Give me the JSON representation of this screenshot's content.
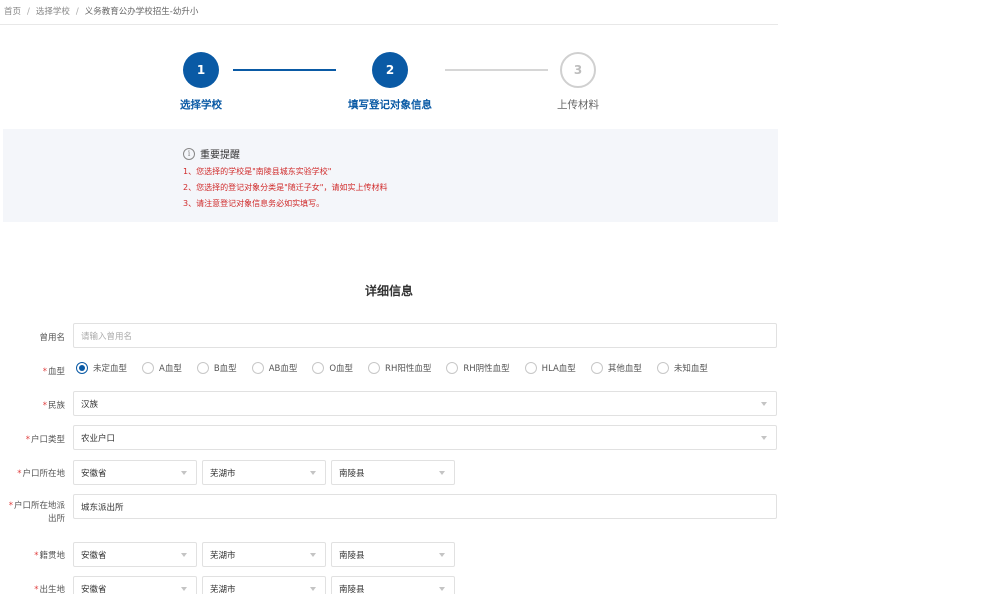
{
  "breadcrumb": {
    "home": "首页",
    "select_school": "选择学校",
    "current": "义务教育公办学校招生-幼升小"
  },
  "steps": [
    {
      "number": "1",
      "label": "选择学校",
      "state": "done"
    },
    {
      "number": "2",
      "label": "填写登记对象信息",
      "state": "done"
    },
    {
      "number": "3",
      "label": "上传材料",
      "state": "todo"
    }
  ],
  "notice": {
    "icon": "info-icon",
    "icon_glyph": "i",
    "title": "重要提醒",
    "lines": [
      "1、您选择的学校是\"南陵县城东实验学校\"",
      "2、您选择的登记对象分类是\"随迁子女\"，请如实上传材料",
      "3、请注意登记对象信息务必如实填写。"
    ]
  },
  "section_title": "详细信息",
  "form": {
    "former_name": {
      "label": "曾用名",
      "placeholder": "请输入曾用名"
    },
    "blood_type": {
      "label": "血型",
      "options": [
        "未定血型",
        "A血型",
        "B血型",
        "AB血型",
        "O血型",
        "RH阳性血型",
        "RH阴性血型",
        "HLA血型",
        "其他血型",
        "未知血型"
      ],
      "selected": "未定血型"
    },
    "ethnicity": {
      "label": "民族",
      "value": "汉族"
    },
    "hukou_type": {
      "label": "户口类型",
      "value": "农业户口"
    },
    "hukou_location": {
      "label": "户口所在地",
      "province": "安徽省",
      "city": "芜湖市",
      "county": "南陵县"
    },
    "hukou_police": {
      "label": "户口所在地派出所",
      "value": "城东派出所"
    },
    "native_place": {
      "label": "籍贯地",
      "province": "安徽省",
      "city": "芜湖市",
      "county": "南陵县"
    },
    "birthplace": {
      "label": "出生地",
      "province": "安徽省",
      "city": "芜湖市",
      "county": "南陵县"
    }
  },
  "colors": {
    "primary": "#0a5aa5",
    "warning_text": "#d02a2a",
    "required": "#e04040",
    "notice_bg": "#f4f6fa"
  }
}
